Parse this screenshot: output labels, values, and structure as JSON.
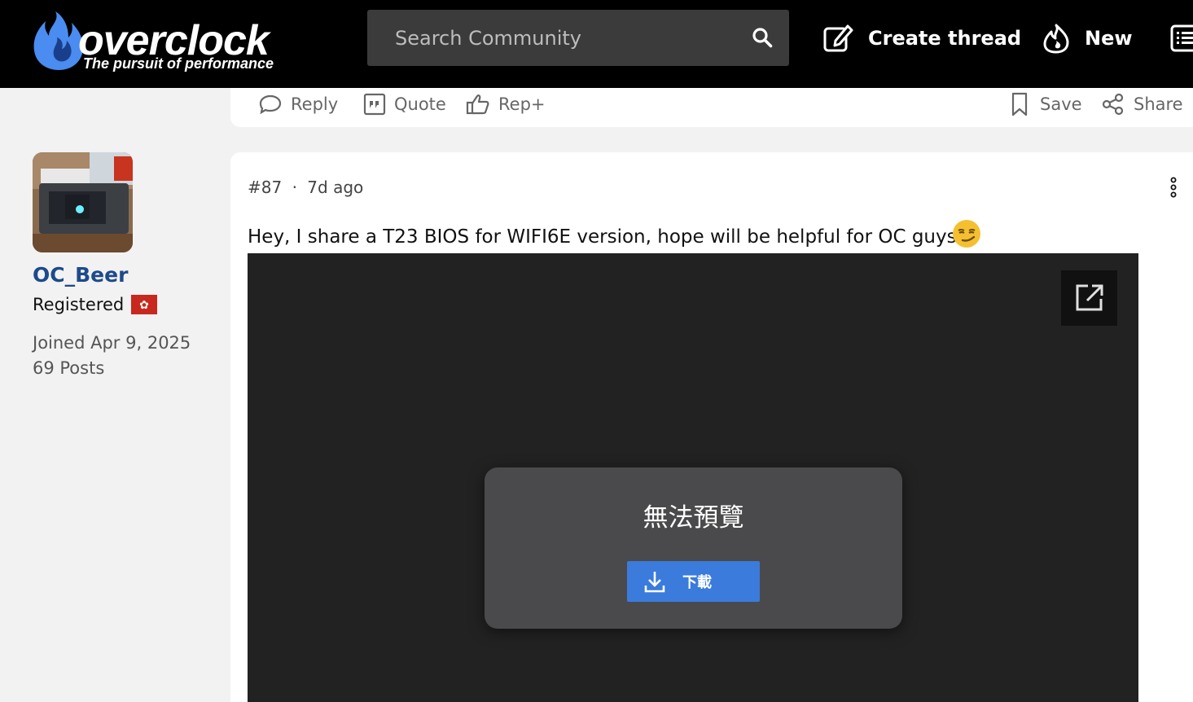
{
  "header": {
    "logo_word": "overclock",
    "logo_tagline": "The pursuit of performance",
    "search_placeholder": "Search Community",
    "create_thread_label": "Create thread",
    "new_label": "New"
  },
  "prev_post_actions": {
    "reply_label": "Reply",
    "quote_label": "Quote",
    "rep_label": "Rep+",
    "save_label": "Save",
    "share_label": "Share"
  },
  "author": {
    "username": "OC_Beer",
    "role": "Registered",
    "flag_icon": "hong-kong-flag-icon",
    "joined": "Joined Apr 9, 2025",
    "posts": "69 Posts"
  },
  "post": {
    "number": "#87",
    "separator": "·",
    "time_ago": "7d ago",
    "text": "Hey, I share a T23 BIOS for WIFI6E version, hope will be helpful for OC guys",
    "emoji": "smirking-face-emoji"
  },
  "preview": {
    "message": "無法預覽",
    "download_label": "下載"
  },
  "colors": {
    "header_bg": "#000000",
    "username": "#1d4a8a",
    "download_button": "#3a7bdc",
    "logo_flame": "#4a8cf0"
  }
}
